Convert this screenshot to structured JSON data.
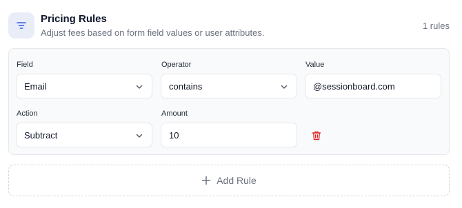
{
  "header": {
    "icon": "filter-icon",
    "title": "Pricing Rules",
    "subtitle": "Adjust fees based on form field values or user attributes.",
    "count": "1 rules"
  },
  "rule": {
    "field": {
      "label": "Field",
      "value": "Email"
    },
    "operator": {
      "label": "Operator",
      "value": "contains"
    },
    "value": {
      "label": "Value",
      "value": "@sessionboard.com"
    },
    "action": {
      "label": "Action",
      "value": "Subtract"
    },
    "amount": {
      "label": "Amount",
      "value": "10"
    },
    "delete_icon": "trash-icon"
  },
  "add_rule": {
    "icon": "plus-icon",
    "label": "Add Rule"
  },
  "colors": {
    "accent": "#3b5bdb",
    "danger": "#dc2626",
    "muted": "#6b7280"
  }
}
